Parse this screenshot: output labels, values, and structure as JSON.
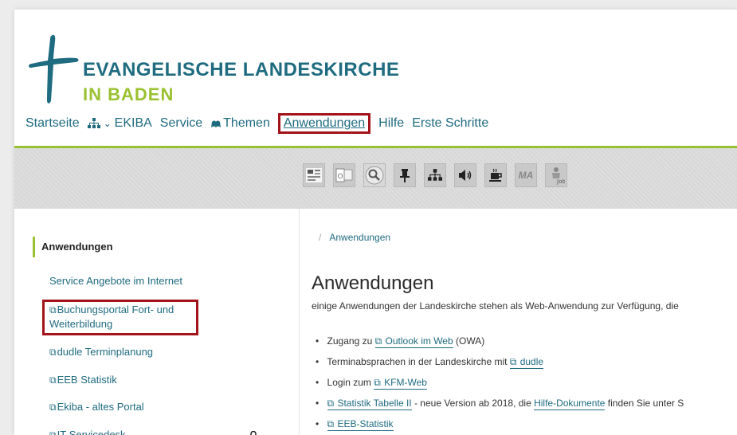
{
  "brand": {
    "line1": "EVANGELISCHE LANDESKIRCHE",
    "line2": "IN BADEN"
  },
  "nav": {
    "home": "Startseite",
    "sitemap_icon": "sitemap-icon",
    "chevron": "⌄",
    "ekiba": "EKIBA",
    "service": "Service",
    "themen_icon": "cloud-icon",
    "themen": "Themen",
    "anwendungen": "Anwendungen",
    "hilfe": "Hilfe",
    "erste_schritte": "Erste Schritte"
  },
  "toolbar": {
    "icons": [
      "newspaper-icon",
      "outlook-icon",
      "search-icon",
      "pin-icon",
      "sitemap-icon",
      "speaker-icon",
      "coffee-icon",
      "ma-icon",
      "jobs-icon"
    ],
    "ma_label": "MA"
  },
  "sidebar": {
    "title": "Anwendungen",
    "items": [
      {
        "label": "Service Angebote im Internet",
        "external": false
      },
      {
        "label": "Buchungsportal Fort- und",
        "label2": "Weiterbildung",
        "external": true
      },
      {
        "label": "dudle Terminplanung",
        "external": true
      },
      {
        "label": "EEB Statistik",
        "external": true
      },
      {
        "label": "Ekiba - altes Portal",
        "external": true
      },
      {
        "label": "IT-Servicedesk",
        "external": true,
        "locked": true
      }
    ],
    "external_glyph": "⧉",
    "lock_glyph": "🔒"
  },
  "content": {
    "breadcrumb_sep": "/",
    "breadcrumb": "Anwendungen",
    "title": "Anwendungen",
    "intro": "einige Anwendungen der Landeskirche stehen als Web-Anwendung zur Verfügung, die",
    "list": [
      {
        "pre": "Zugang zu ",
        "link": "Outlook im Web",
        "post": " (OWA)"
      },
      {
        "pre": "Terminabsprachen in der Landeskirche mit ",
        "link": "dudle",
        "post": ""
      },
      {
        "pre": "Login zum ",
        "link": "KFM-Web",
        "post": ""
      },
      {
        "pre": "",
        "link": "Statistik Tabelle II",
        "post": " - neue Version ab 2018, die ",
        "link2": "Hilfe-Dokumente",
        "post2": " finden Sie unter S"
      },
      {
        "pre": "",
        "link": "EEB-Statistik",
        "post": ""
      }
    ]
  },
  "colors": {
    "brand_teal": "#1f6b80",
    "brand_green": "#9ac131",
    "highlight_red": "#a3131a"
  }
}
